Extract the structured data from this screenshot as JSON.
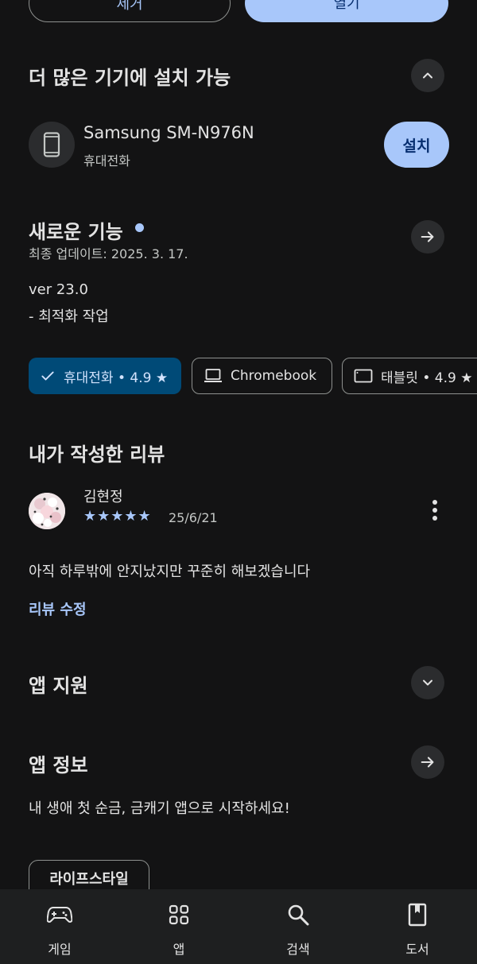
{
  "top_buttons": {
    "uninstall_label": "제거",
    "open_label": "열기"
  },
  "more_devices": {
    "title": "더 많은 기기에 설치 가능",
    "collapse_icon": "chevron-up-icon",
    "device": {
      "name": "Samsung SM-N976N",
      "type": "휴대전화",
      "icon": "phone-icon",
      "install_label": "설치"
    }
  },
  "whats_new": {
    "title": "새로운 기능",
    "dot_color": "#a8c7fa",
    "updated": "최종 업데이트: 2025. 3. 17.",
    "version": "ver 23.0",
    "note": "- 최적화 작업",
    "arrow_icon": "arrow-right-icon"
  },
  "device_chips": [
    {
      "label": "휴대전화 • 4.9 ★",
      "icon": "check-icon",
      "selected": true
    },
    {
      "label": "Chromebook",
      "icon": "laptop-icon",
      "selected": false
    },
    {
      "label": "태블릿 • 4.9 ★",
      "icon": "tablet-icon",
      "selected": false
    }
  ],
  "my_review": {
    "title": "내가 작성한 리뷰",
    "author": "김현정",
    "stars": "★★★★★",
    "rating": 5,
    "date": "25/6/21",
    "text": "아직 하루밖에 안지났지만 꾸준히 해보겠습니다",
    "edit_label": "리뷰 수정",
    "more_icon": "more-vert-icon"
  },
  "app_support": {
    "title": "앱 지원",
    "expand_icon": "chevron-down-icon"
  },
  "app_info": {
    "title": "앱 정보",
    "description": "내 생애 첫 순금, 금캐기 앱으로 시작하세요!",
    "tag": "라이프스타일",
    "arrow_icon": "arrow-right-icon"
  },
  "bottom_nav": [
    {
      "label": "게임",
      "icon": "gamepad-icon"
    },
    {
      "label": "앱",
      "icon": "apps-grid-icon"
    },
    {
      "label": "검색",
      "icon": "search-icon"
    },
    {
      "label": "도서",
      "icon": "book-icon"
    }
  ],
  "colors": {
    "background": "#131314",
    "accent": "#a8c7fa",
    "chip_selected": "#004a77"
  }
}
